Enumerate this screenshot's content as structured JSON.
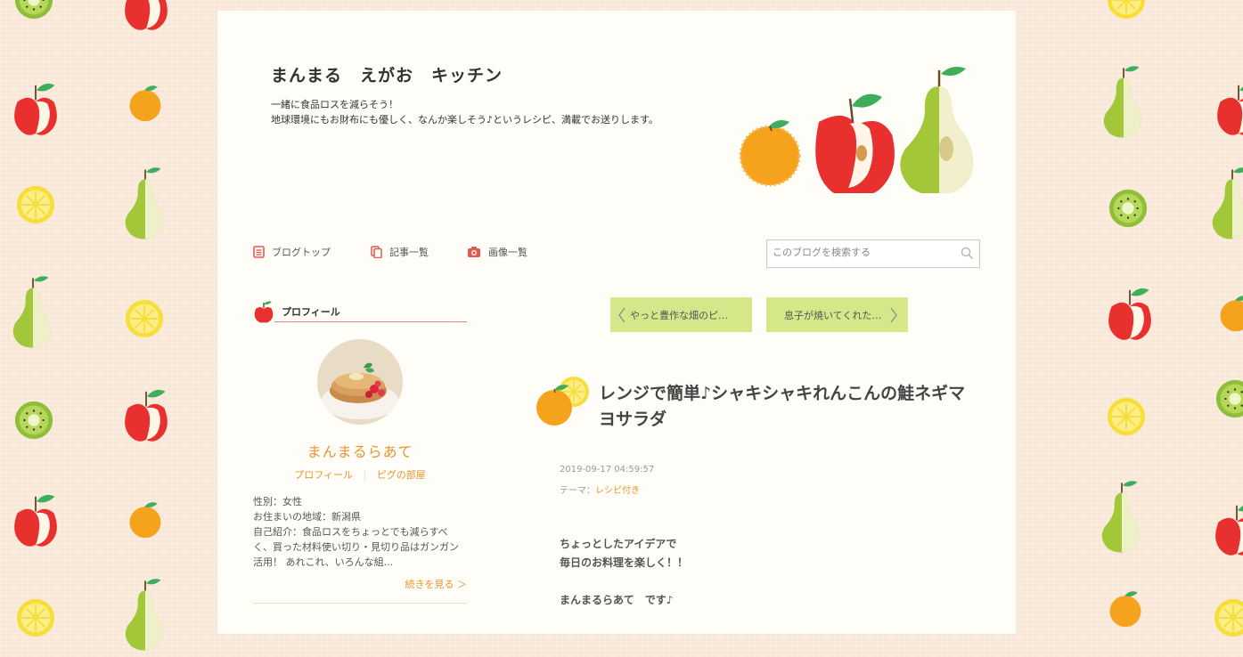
{
  "blog": {
    "title": "まんまる　えがお　キッチン",
    "description": [
      "一緒に食品ロスを減らそう！",
      "地球環境にもお財布にも優しく、なんか楽しそう♪というレシピ、満載でお送りします。"
    ]
  },
  "global_nav": {
    "items": [
      {
        "label": "ブログトップ",
        "icon": "document-icon"
      },
      {
        "label": "記事一覧",
        "icon": "copy-icon"
      },
      {
        "label": "画像一覧",
        "icon": "camera-icon"
      }
    ]
  },
  "search": {
    "placeholder": "このブログを検索する"
  },
  "profile": {
    "heading": "プロフィール",
    "nickname": "まんまるらあて",
    "links": [
      "プロフィール",
      "ピグの部屋"
    ],
    "lines": [
      "性別：女性",
      "お住まいの地域：新潟県",
      "自己紹介：食品ロスをちょっとでも減らすべ",
      "く、買った材料使い切り・見切り品はガンガン",
      "活用！ あれこれ、いろんな組..."
    ],
    "more": "続きを見る ＞"
  },
  "pager": {
    "prev": "やっと豊作な畑のピ…",
    "next": "息子が焼いてくれた…"
  },
  "entry": {
    "title": "レンジで簡単♪シャキシャキれんこんの鮭ネギマヨサラダ",
    "date": "2019-09-17 04:59:57",
    "theme_label": "テーマ：",
    "theme": "レシピ付き",
    "body": [
      "ちょっとしたアイデアで",
      "毎日のお料理を楽しく！！",
      "",
      "まんまるらあて　です♪"
    ]
  },
  "colors": {
    "accent_orange": "#e8952e",
    "pager_green": "#d4e88a",
    "icon_red": "#e25a4e",
    "page_bg": "#fffdf7",
    "body_bg": "#f8e7d6"
  }
}
